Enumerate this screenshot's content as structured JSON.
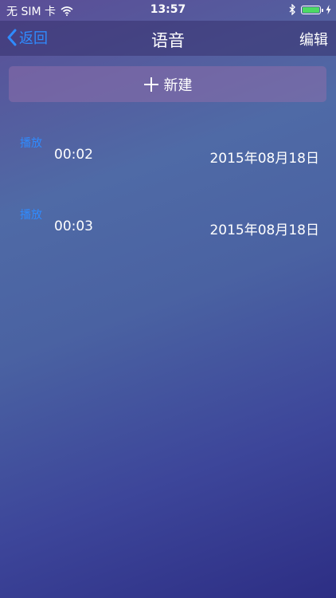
{
  "status_bar": {
    "carrier": "无 SIM 卡",
    "time": "13:57",
    "battery_level": 1.0,
    "battery_color": "#4cd964"
  },
  "nav": {
    "back_label": "返回",
    "title": "语音",
    "edit_label": "编辑",
    "accent_color": "#2f8bff"
  },
  "new_button": {
    "label": "新建",
    "icon": "plus-icon"
  },
  "records": [
    {
      "play_label": "播放",
      "duration": "00:02",
      "date": "2015年08月18日"
    },
    {
      "play_label": "播放",
      "duration": "00:03",
      "date": "2015年08月18日"
    }
  ]
}
